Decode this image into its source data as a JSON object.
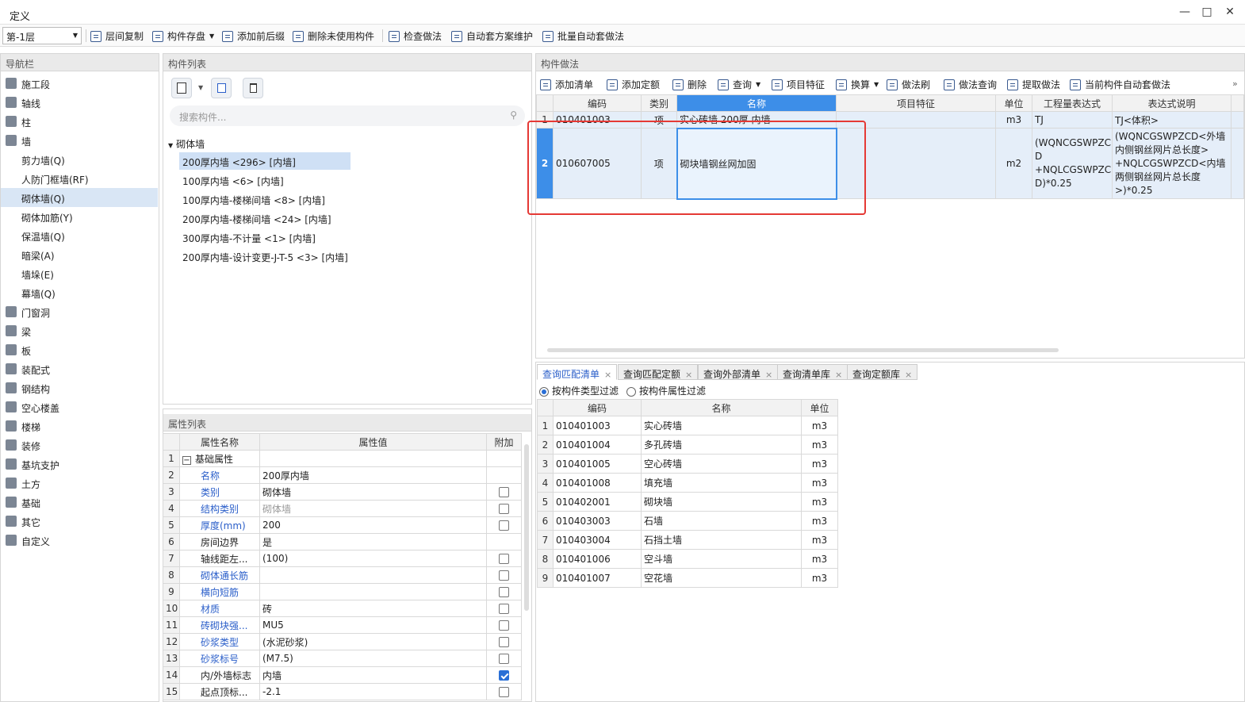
{
  "window": {
    "title": "定义"
  },
  "toolbar": {
    "floor": "第-1层",
    "buttons": [
      "层间复制",
      "构件存盘",
      "添加前后缀",
      "删除未使用构件",
      "检查做法",
      "自动套方案维护",
      "批量自动套做法"
    ]
  },
  "nav": {
    "title": "导航栏",
    "items": [
      {
        "label": "施工段",
        "sub": false
      },
      {
        "label": "轴线",
        "sub": false
      },
      {
        "label": "柱",
        "sub": false
      },
      {
        "label": "墙",
        "sub": false
      },
      {
        "label": "剪力墙(Q)",
        "sub": true
      },
      {
        "label": "人防门框墙(RF)",
        "sub": true
      },
      {
        "label": "砌体墙(Q)",
        "sub": true,
        "selected": true
      },
      {
        "label": "砌体加筋(Y)",
        "sub": true
      },
      {
        "label": "保温墙(Q)",
        "sub": true
      },
      {
        "label": "暗梁(A)",
        "sub": true
      },
      {
        "label": "墙垛(E)",
        "sub": true
      },
      {
        "label": "幕墙(Q)",
        "sub": true
      },
      {
        "label": "门窗洞",
        "sub": false
      },
      {
        "label": "梁",
        "sub": false
      },
      {
        "label": "板",
        "sub": false
      },
      {
        "label": "装配式",
        "sub": false
      },
      {
        "label": "钢结构",
        "sub": false
      },
      {
        "label": "空心楼盖",
        "sub": false
      },
      {
        "label": "楼梯",
        "sub": false
      },
      {
        "label": "装修",
        "sub": false
      },
      {
        "label": "基坑支护",
        "sub": false
      },
      {
        "label": "土方",
        "sub": false
      },
      {
        "label": "基础",
        "sub": false
      },
      {
        "label": "其它",
        "sub": false
      },
      {
        "label": "自定义",
        "sub": false
      }
    ]
  },
  "components": {
    "title": "构件列表",
    "search_placeholder": "搜索构件...",
    "group": "砌体墙",
    "items": [
      "200厚内墙 <296> [内墙]",
      "100厚内墙 <6> [内墙]",
      "100厚内墙-楼梯间墙 <8> [内墙]",
      "200厚内墙-楼梯间墙 <24> [内墙]",
      "300厚内墙-不计量 <1> [内墙]",
      "200厚内墙-设计变更-J-T-5 <3> [内墙]"
    ]
  },
  "properties": {
    "title": "属性列表",
    "columns": [
      "属性名称",
      "属性值",
      "附加"
    ],
    "rows": [
      {
        "n": "1",
        "name": "基础属性",
        "value": "",
        "blue": false,
        "group": true,
        "cb": null
      },
      {
        "n": "2",
        "name": "名称",
        "value": "200厚内墙",
        "blue": true,
        "cb": null
      },
      {
        "n": "3",
        "name": "类别",
        "value": "砌体墙",
        "blue": true,
        "cb": false
      },
      {
        "n": "4",
        "name": "结构类别",
        "value": "砌体墙",
        "blue": true,
        "gray": true,
        "cb": false
      },
      {
        "n": "5",
        "name": "厚度(mm)",
        "value": "200",
        "blue": true,
        "cb": false
      },
      {
        "n": "6",
        "name": "房间边界",
        "value": "是",
        "blue": false,
        "cb": null
      },
      {
        "n": "7",
        "name": "轴线距左...",
        "value": "(100)",
        "blue": false,
        "cb": false
      },
      {
        "n": "8",
        "name": "砌体通长筋",
        "value": "",
        "blue": true,
        "cb": false
      },
      {
        "n": "9",
        "name": "横向短筋",
        "value": "",
        "blue": true,
        "cb": false
      },
      {
        "n": "10",
        "name": "材质",
        "value": "砖",
        "blue": true,
        "cb": false
      },
      {
        "n": "11",
        "name": "砖砌块强...",
        "value": "MU5",
        "blue": true,
        "cb": false
      },
      {
        "n": "12",
        "name": "砂浆类型",
        "value": "(水泥砂浆)",
        "blue": true,
        "cb": false
      },
      {
        "n": "13",
        "name": "砂浆标号",
        "value": "(M7.5)",
        "blue": true,
        "cb": false
      },
      {
        "n": "14",
        "name": "内/外墙标志",
        "value": "内墙",
        "blue": false,
        "cb": true
      },
      {
        "n": "15",
        "name": "起点顶标...",
        "value": "-2.1",
        "blue": false,
        "cb": false
      }
    ]
  },
  "methods": {
    "title": "构件做法",
    "toolbar": [
      "添加清单",
      "添加定额",
      "删除",
      "查询",
      "项目特征",
      "换算",
      "做法刷",
      "做法查询",
      "提取做法",
      "当前构件自动套做法"
    ],
    "columns": [
      "编码",
      "类别",
      "名称",
      "项目特征",
      "单位",
      "工程量表达式",
      "表达式说明"
    ],
    "rows": [
      {
        "n": "1",
        "code": "010401003",
        "type": "项",
        "name": "实心砖墙 200厚 内墙",
        "feature": "",
        "unit": "m3",
        "expr": "TJ",
        "desc": "TJ<体积>"
      },
      {
        "n": "2",
        "code": "010607005",
        "type": "项",
        "name": "砌块墙钢丝网加固",
        "feature": "",
        "unit": "m2",
        "expr_lines": [
          "(WQNCGSWPZC",
          "D",
          "+NQLCGSWPZC",
          "D)*0.25"
        ],
        "desc_lines": [
          "(WQNCGSWPZCD<外墙",
          "内侧钢丝网片总长度>",
          "+NQLCGSWPZCD<内墙",
          "两侧钢丝网片总长度",
          ">)*0.25"
        ]
      }
    ]
  },
  "query": {
    "tabs": [
      "查询匹配清单",
      "查询匹配定额",
      "查询外部清单",
      "查询清单库",
      "查询定额库"
    ],
    "filters": [
      "按构件类型过滤",
      "按构件属性过滤"
    ],
    "columns": [
      "编码",
      "名称",
      "单位"
    ],
    "rows": [
      {
        "n": "1",
        "code": "010401003",
        "name": "实心砖墙",
        "unit": "m3"
      },
      {
        "n": "2",
        "code": "010401004",
        "name": "多孔砖墙",
        "unit": "m3"
      },
      {
        "n": "3",
        "code": "010401005",
        "name": "空心砖墙",
        "unit": "m3"
      },
      {
        "n": "4",
        "code": "010401008",
        "name": "填充墙",
        "unit": "m3"
      },
      {
        "n": "5",
        "code": "010402001",
        "name": "砌块墙",
        "unit": "m3"
      },
      {
        "n": "6",
        "code": "010403003",
        "name": "石墙",
        "unit": "m3"
      },
      {
        "n": "7",
        "code": "010403004",
        "name": "石挡土墙",
        "unit": "m3"
      },
      {
        "n": "8",
        "code": "010401006",
        "name": "空斗墙",
        "unit": "m3"
      },
      {
        "n": "9",
        "code": "010401007",
        "name": "空花墙",
        "unit": "m3"
      }
    ]
  }
}
